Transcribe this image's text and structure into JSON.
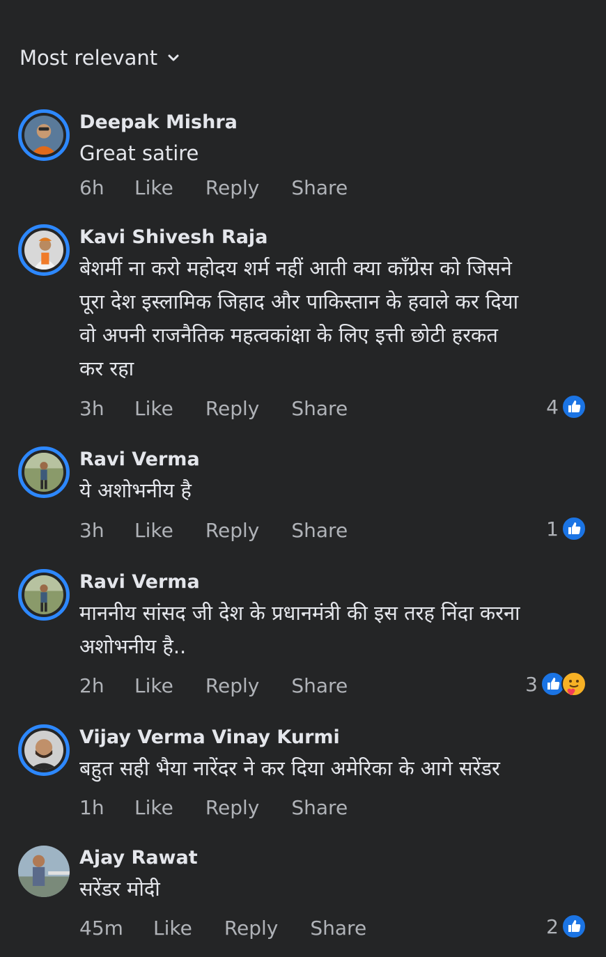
{
  "sort": {
    "label": "Most relevant"
  },
  "actions": {
    "like": "Like",
    "reply": "Reply",
    "share": "Share"
  },
  "colors": {
    "background": "#242526",
    "accent": "#2d88ff",
    "secondary_text": "#b0b3b8"
  },
  "comments": [
    {
      "name": "Deepak Mishra",
      "text": "Great satire",
      "time": "6h",
      "reactions": ""
    },
    {
      "name": "Kavi Shivesh Raja",
      "text": "बेशर्मी ना करो महोदय शर्म नहीं आती क्या काँग्रेस को जिसने\nपूरा देश इस्लामिक जिहाद और पाकिस्तान के हवाले कर दिया\nवो अपनी राजनैतिक महत्वकांक्षा के लिए इत्ती छोटी हरकत\nकर रहा",
      "time": "3h",
      "reactions": "4"
    },
    {
      "name": "Ravi Verma",
      "text": "ये अशोभनीय है",
      "time": "3h",
      "reactions": "1"
    },
    {
      "name": "Ravi Verma",
      "text": "माननीय सांसद जी देश के प्रधानमंत्री की इस तरह निंदा करना\nअशोभनीय है..",
      "time": "2h",
      "reactions": "3"
    },
    {
      "name": "Vijay Verma Vinay Kurmi",
      "text": "बहुत सही भैया नारेंदर ने कर दिया अमेरिका के आगे सरेंडर",
      "time": "1h",
      "reactions": ""
    },
    {
      "name": "Ajay Rawat",
      "text": "सरेंडर मोदी",
      "time": "45m",
      "reactions": "2"
    }
  ]
}
